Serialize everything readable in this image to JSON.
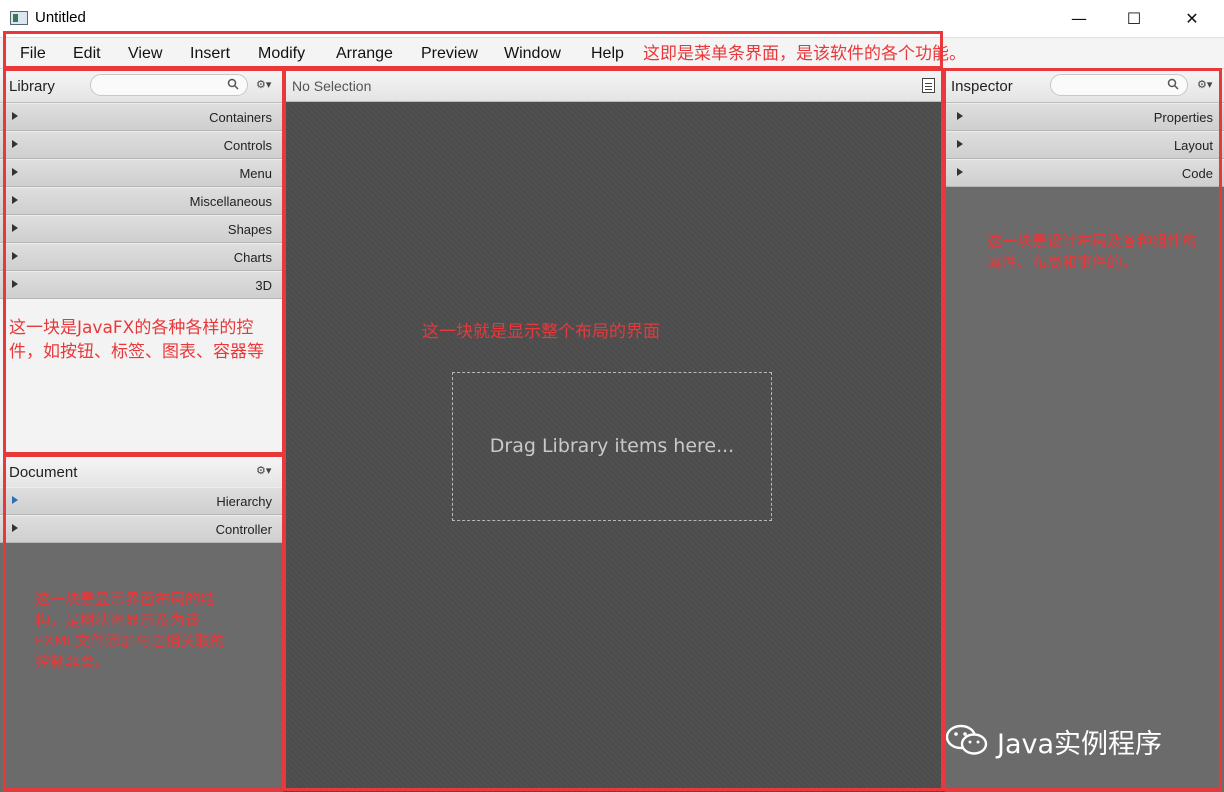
{
  "window": {
    "title": "Untitled",
    "minimize": "—",
    "maximize": "☐",
    "close": "✕"
  },
  "menubar": {
    "items": [
      "File",
      "Edit",
      "View",
      "Insert",
      "Modify",
      "Arrange",
      "Preview",
      "Window",
      "Help"
    ],
    "annotation": "这即是菜单条界面，是该软件的各个功能。"
  },
  "library": {
    "title": "Library",
    "sections": [
      "Containers",
      "Controls",
      "Menu",
      "Miscellaneous",
      "Shapes",
      "Charts",
      "3D"
    ],
    "annotation": "这一块是JavaFX的各种各样的控件，如按钮、标签、图表、容器等"
  },
  "document": {
    "title": "Document",
    "sections": [
      "Hierarchy",
      "Controller"
    ],
    "annotation": "这一块是显示界面布局的结构，是树状图显示及为该FXML文件添加与之相关联的控制器类。"
  },
  "content": {
    "selection": "No Selection",
    "drop_hint": "Drag Library items here...",
    "annotation": "这一块就是显示整个布局的界面"
  },
  "inspector": {
    "title": "Inspector",
    "sections": [
      "Properties",
      "Layout",
      "Code"
    ],
    "annotation": "这一块是设计布局及各种组件的属性、布局和事件的。"
  },
  "watermark": {
    "text": "Java实例程序"
  },
  "colors": {
    "annotation": "#e8383a",
    "canvas": "#4c4c4c",
    "panel_dark": "#6b6b6b"
  }
}
